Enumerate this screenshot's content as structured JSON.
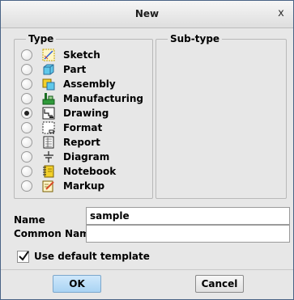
{
  "dialog": {
    "title": "New",
    "close_glyph": "x"
  },
  "type_group": {
    "label": "Type",
    "options": [
      {
        "label": "Sketch",
        "icon": "sketch-icon",
        "checked": false
      },
      {
        "label": "Part",
        "icon": "part-icon",
        "checked": false
      },
      {
        "label": "Assembly",
        "icon": "assembly-icon",
        "checked": false
      },
      {
        "label": "Manufacturing",
        "icon": "manufacturing-icon",
        "checked": false
      },
      {
        "label": "Drawing",
        "icon": "drawing-icon",
        "checked": true
      },
      {
        "label": "Format",
        "icon": "format-icon",
        "checked": false
      },
      {
        "label": "Report",
        "icon": "report-icon",
        "checked": false
      },
      {
        "label": "Diagram",
        "icon": "diagram-icon",
        "checked": false
      },
      {
        "label": "Notebook",
        "icon": "notebook-icon",
        "checked": false
      },
      {
        "label": "Markup",
        "icon": "markup-icon",
        "checked": false
      }
    ]
  },
  "subtype_group": {
    "label": "Sub-type"
  },
  "fields": {
    "name_label": "Name",
    "name_value": "sample",
    "common_name_label": "Common Name",
    "common_name_value": ""
  },
  "template": {
    "label": "Use default template",
    "checked": true
  },
  "buttons": {
    "ok_label": "OK",
    "cancel_label": "Cancel"
  }
}
